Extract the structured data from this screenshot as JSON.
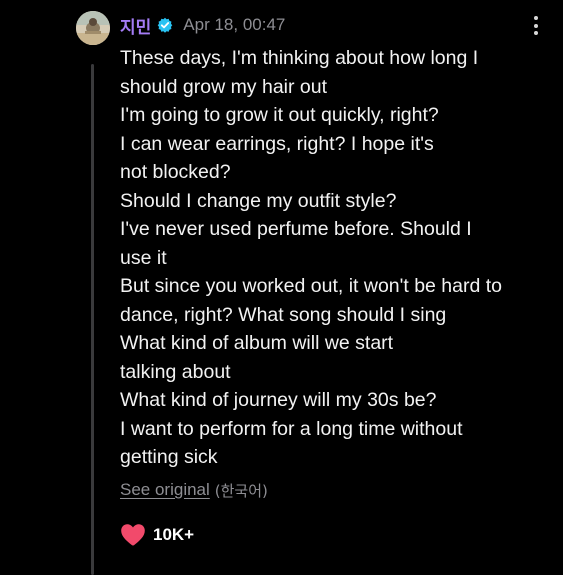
{
  "comment": {
    "author": "지민",
    "verified_icon": "verified-badge-icon",
    "timestamp": "Apr 18, 00:47",
    "more_icon": "more-vertical-icon",
    "body_lines": [
      "These days, I'm thinking about how long I",
      "should grow my hair out",
      "I'm going to grow it out quickly, right?",
      "I can wear earrings, right? I hope it's",
      "not blocked?",
      "Should I change my outfit style?",
      "I've never used perfume before. Should I",
      "use it",
      "But since you worked out, it won't be hard to",
      "dance, right? What song should I sing",
      "What kind of album will we start",
      "talking about",
      "What kind of journey will my 30s be?",
      "I want to perform for a long time without",
      "getting sick"
    ],
    "see_original_label": "See original",
    "original_language": "(한국어)",
    "like_icon": "heart-icon",
    "like_count": "10K+"
  },
  "colors": {
    "background": "#000000",
    "author": "#a47cf5",
    "verified_badge": "#29c2f2",
    "secondary_text": "#8e8e93",
    "heart": "#f24a6b",
    "thread_line": "#3a3a3c"
  }
}
